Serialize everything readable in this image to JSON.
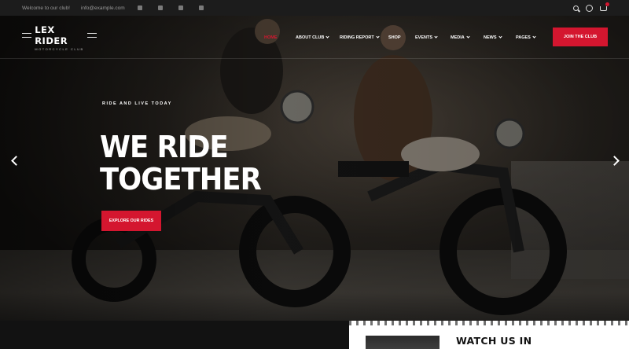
{
  "topbar": {
    "welcome": "Welcome to our club!",
    "email": "info@example.com",
    "social_icons": [
      "facebook-icon",
      "instagram-icon",
      "twitter-icon",
      "youtube-icon"
    ],
    "right_icons": [
      "search-icon",
      "user-icon",
      "cart-icon"
    ]
  },
  "header": {
    "logo_name": "LEX RIDER",
    "logo_sub": "MOTORCYCLE CLUB",
    "nav": [
      {
        "label": "Home",
        "has_dropdown": false,
        "active": true
      },
      {
        "label": "About club",
        "has_dropdown": true
      },
      {
        "label": "Riding report",
        "has_dropdown": true
      },
      {
        "label": "Shop",
        "has_dropdown": false
      },
      {
        "label": "Events",
        "has_dropdown": true
      },
      {
        "label": "Media",
        "has_dropdown": true
      },
      {
        "label": "News",
        "has_dropdown": true
      },
      {
        "label": "Pages",
        "has_dropdown": true
      }
    ],
    "join_label": "Join the club"
  },
  "hero": {
    "tagline": "RIDE AND LIVE TODAY",
    "title_line1": "WE RIDE",
    "title_line2": "TOGETHER",
    "button_label": "EXPLORE OUR RIDES"
  },
  "watch": {
    "heading": "WATCH US IN"
  },
  "colors": {
    "accent": "#d4162f",
    "topbar_bg": "#1c1c1c",
    "text_light": "#ffffff"
  }
}
